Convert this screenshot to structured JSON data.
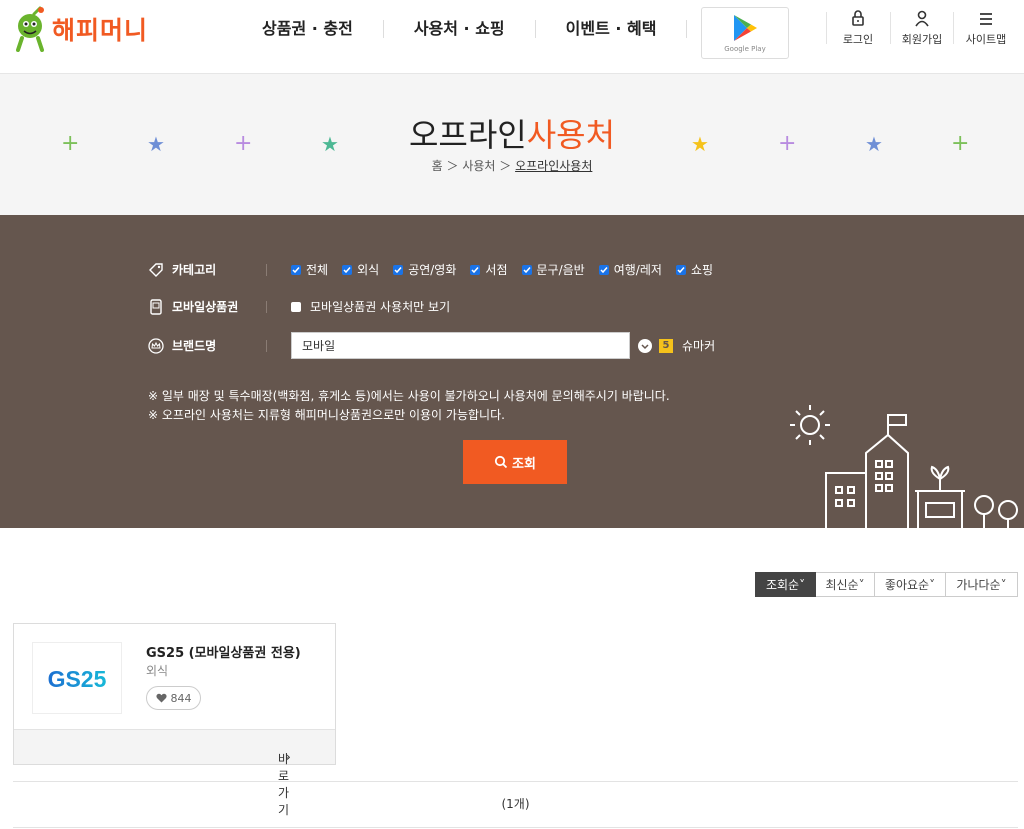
{
  "brand": {
    "name": "해피머니",
    "color": "#f15a22"
  },
  "gnb": [
    "상품권 · 충전",
    "사용처 · 쇼핑",
    "이벤트 · 혜택"
  ],
  "google_play": {
    "label": "Google Play"
  },
  "util": {
    "login": "로그인",
    "join": "회원가입",
    "sitemap": "사이트맵"
  },
  "page": {
    "title_main": "오프라인",
    "title_accent": "사용처",
    "breadcrumb": [
      "홈",
      "사용처",
      "오프라인사용처"
    ]
  },
  "filters": {
    "category_label": "카테고리",
    "categories": [
      "전체",
      "외식",
      "공연/영화",
      "서점",
      "문구/음반",
      "여행/레저",
      "쇼핑"
    ],
    "mobile_label": "모바일상품권",
    "mobile_option": "모바일상품권 사용처만 보기",
    "brand_label": "브랜드명",
    "brand_value": "모바일",
    "suggest_badge": "5",
    "suggest_text": "슈마커",
    "notices": [
      "※ 일부 매장 및 특수매장(백화점, 휴게소 등)에서는 사용이 불가하오니 사용처에 문의해주시기 바랍니다.",
      "※ 오프라인 사용처는 지류형 해피머니상품권으로만 이용이 가능합니다."
    ],
    "search_button": "조회"
  },
  "sort": [
    "조회순",
    "최신순",
    "좋아요순",
    "가나다순"
  ],
  "results": [
    {
      "title": "GS25 (모바일상품권 전용)",
      "category": "외식",
      "likes": "844",
      "logo_text": "GS25",
      "link": "바로가기"
    }
  ],
  "count": "(1개)",
  "colors": {
    "accent": "#f15a22",
    "panel": "#65564e",
    "checkbox": "#1a73e8"
  }
}
